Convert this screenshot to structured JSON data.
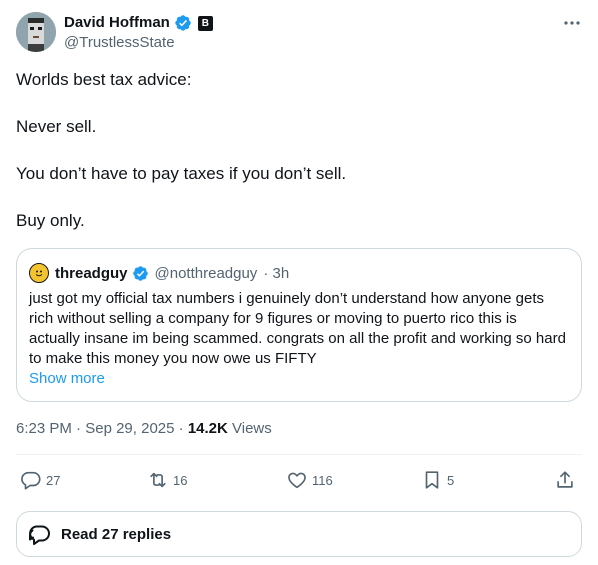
{
  "author": {
    "display_name": "David Hoffman",
    "handle": "@TrustlessState",
    "affiliate_badge": "B"
  },
  "tweet": {
    "lines": [
      "Worlds best tax advice:",
      "Never sell.",
      "You don’t have to pay taxes if you don’t sell.",
      "Buy only."
    ]
  },
  "quote": {
    "display_name": "threadguy",
    "handle": "@notthreadguy",
    "time": "· 3h",
    "text": "just got my official tax numbers i genuinely don’t understand how anyone gets rich without selling a company for 9 figures or moving to puerto rico this is actually insane im being scammed. congrats on all the profit and working so hard to make this money you now owe us FIFTY",
    "show_more": "Show more"
  },
  "meta": {
    "time": "6:23 PM",
    "sep1": "·",
    "date": "Sep 29, 2025",
    "sep2": "·",
    "views_count": "14.2K",
    "views_label": "Views"
  },
  "actions": {
    "replies": "27",
    "reposts": "16",
    "likes": "116",
    "bookmarks": "5"
  },
  "read_replies": {
    "label": "Read 27 replies"
  },
  "icons": {
    "more": "more-horizontal-icon",
    "verified": "verified-badge-icon",
    "reply": "reply-icon",
    "repost": "repost-icon",
    "like": "heart-icon",
    "bookmark": "bookmark-icon",
    "share": "share-icon",
    "replies_bubble": "speech-bubble-icon"
  },
  "colors": {
    "accent": "#1d9bf0",
    "text_primary": "#0f1419",
    "text_secondary": "#536471",
    "border": "#cfd9de"
  }
}
